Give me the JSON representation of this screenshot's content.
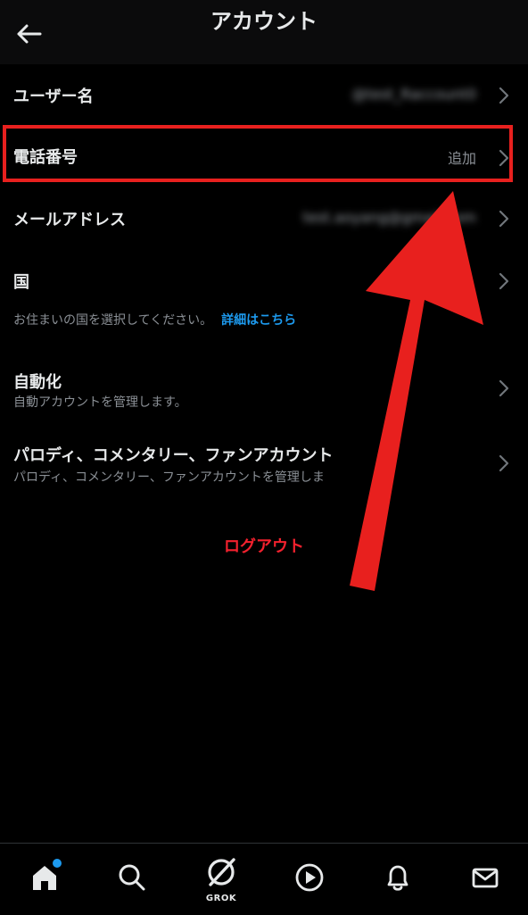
{
  "header": {
    "title": "アカウント",
    "back_icon": "arrow-left-icon"
  },
  "rows": [
    {
      "label": "ユーザー名",
      "value": "@test_Raccount0"
    },
    {
      "label": "電話番号",
      "value": "追加"
    },
    {
      "label": "メールアドレス",
      "value": "test.aoyang@gmail.com"
    },
    {
      "label": "国",
      "value": ""
    }
  ],
  "country_note": {
    "text": "お住まいの国を選択してください。",
    "link": "詳細はこちら"
  },
  "automation": {
    "label": "自動化",
    "sub": "自動アカウントを管理します。"
  },
  "parody": {
    "label": "パロディ、コメンタリー、ファンアカウント",
    "sub": "パロディ、コメンタリー、ファンアカウントを管理しま"
  },
  "logout_label": "ログアウト",
  "tabbar": {
    "items": [
      {
        "icon": "home-icon"
      },
      {
        "icon": "search-icon"
      },
      {
        "icon": "grok-icon",
        "label": "GROK"
      },
      {
        "icon": "play-icon"
      },
      {
        "icon": "bell-icon"
      },
      {
        "icon": "mail-icon"
      }
    ]
  },
  "colors": {
    "background": "#000000",
    "text": "#e7e9ea",
    "secondary_text": "#8b9096",
    "link": "#1d9bf0",
    "danger": "#f4212e",
    "annotation": "#e8201e"
  }
}
